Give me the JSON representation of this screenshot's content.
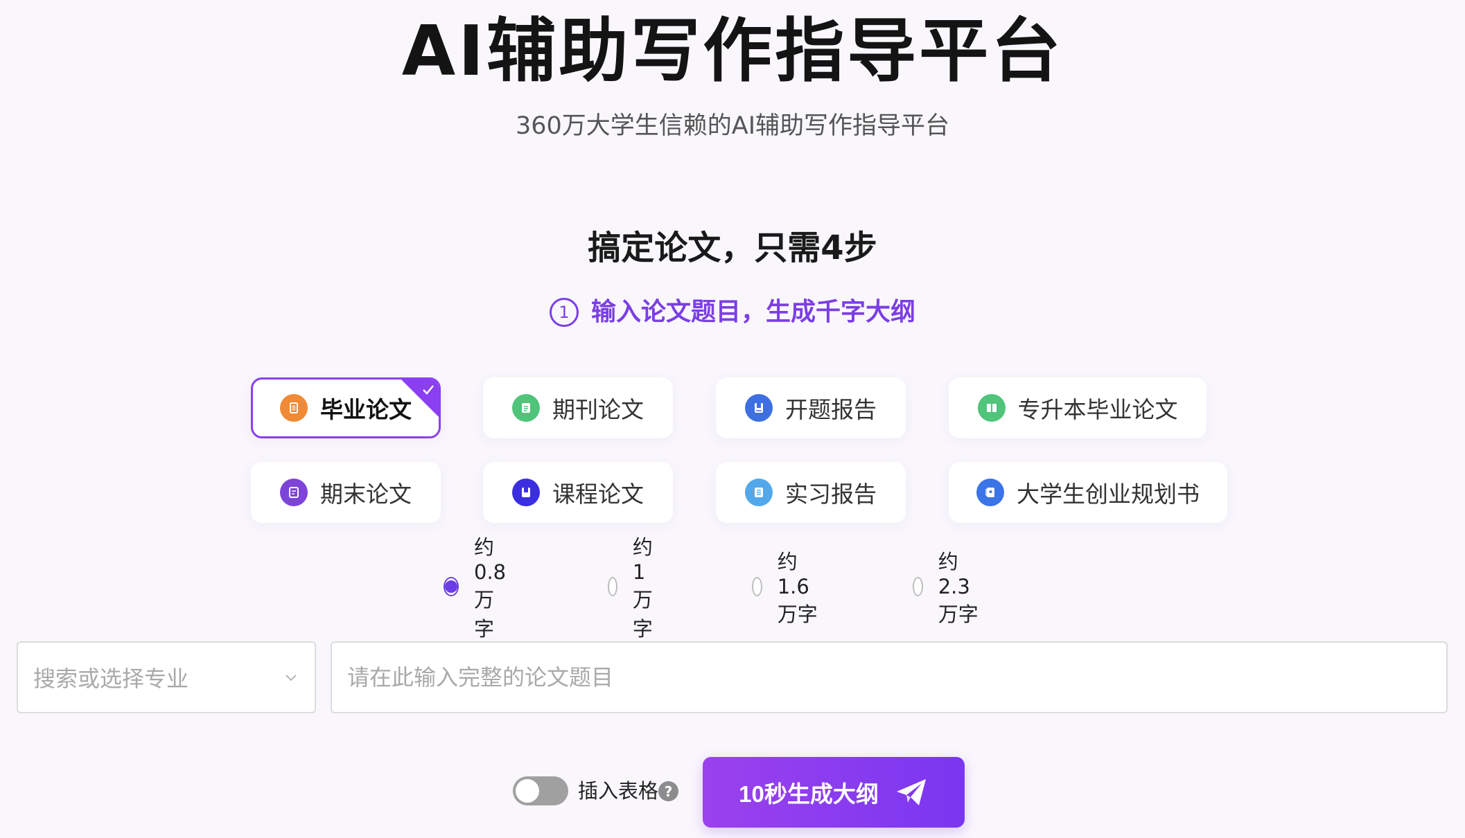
{
  "header": {
    "title": "AI辅助写作指导平台",
    "subtitle": "360万大学生信赖的AI辅助写作指导平台"
  },
  "steps": {
    "title": "搞定论文，只需4步",
    "current_step_number": "1",
    "current_step_text": "输入论文题目，生成千字大纲"
  },
  "paper_types": [
    {
      "label": "毕业论文",
      "icon": "document-icon",
      "color": "#f08a36",
      "selected": true
    },
    {
      "label": "期刊论文",
      "icon": "journal-icon",
      "color": "#4fc47a",
      "selected": false
    },
    {
      "label": "开题报告",
      "icon": "report-icon",
      "color": "#3d6fe0",
      "selected": false
    },
    {
      "label": "专升本毕业论文",
      "icon": "book-icon",
      "color": "#4fc47a",
      "selected": false
    },
    {
      "label": "期末论文",
      "icon": "note-icon",
      "color": "#7d44d8",
      "selected": false
    },
    {
      "label": "课程论文",
      "icon": "course-icon",
      "color": "#3a2ee0",
      "selected": false
    },
    {
      "label": "实习报告",
      "icon": "file-icon",
      "color": "#52a8ea",
      "selected": false
    },
    {
      "label": "大学生创业规划书",
      "icon": "plan-icon",
      "color": "#3b74e6",
      "selected": false
    }
  ],
  "word_counts": [
    {
      "label": "约0.8万字",
      "selected": true
    },
    {
      "label": "约1万字",
      "selected": false
    },
    {
      "label": "约1.6万字",
      "selected": false
    },
    {
      "label": "约2.3万字",
      "selected": false
    }
  ],
  "form": {
    "major_placeholder": "搜索或选择专业",
    "title_placeholder": "请在此输入完整的论文题目",
    "title_value": ""
  },
  "options": {
    "insert_table_label": "插入表格",
    "insert_table_on": false,
    "help_symbol": "?"
  },
  "actions": {
    "generate_label": "10秒生成大纲"
  },
  "colors": {
    "accent": "#7b3fe4",
    "button_gradient_start": "#9b41ee",
    "button_gradient_end": "#7a37f0"
  }
}
